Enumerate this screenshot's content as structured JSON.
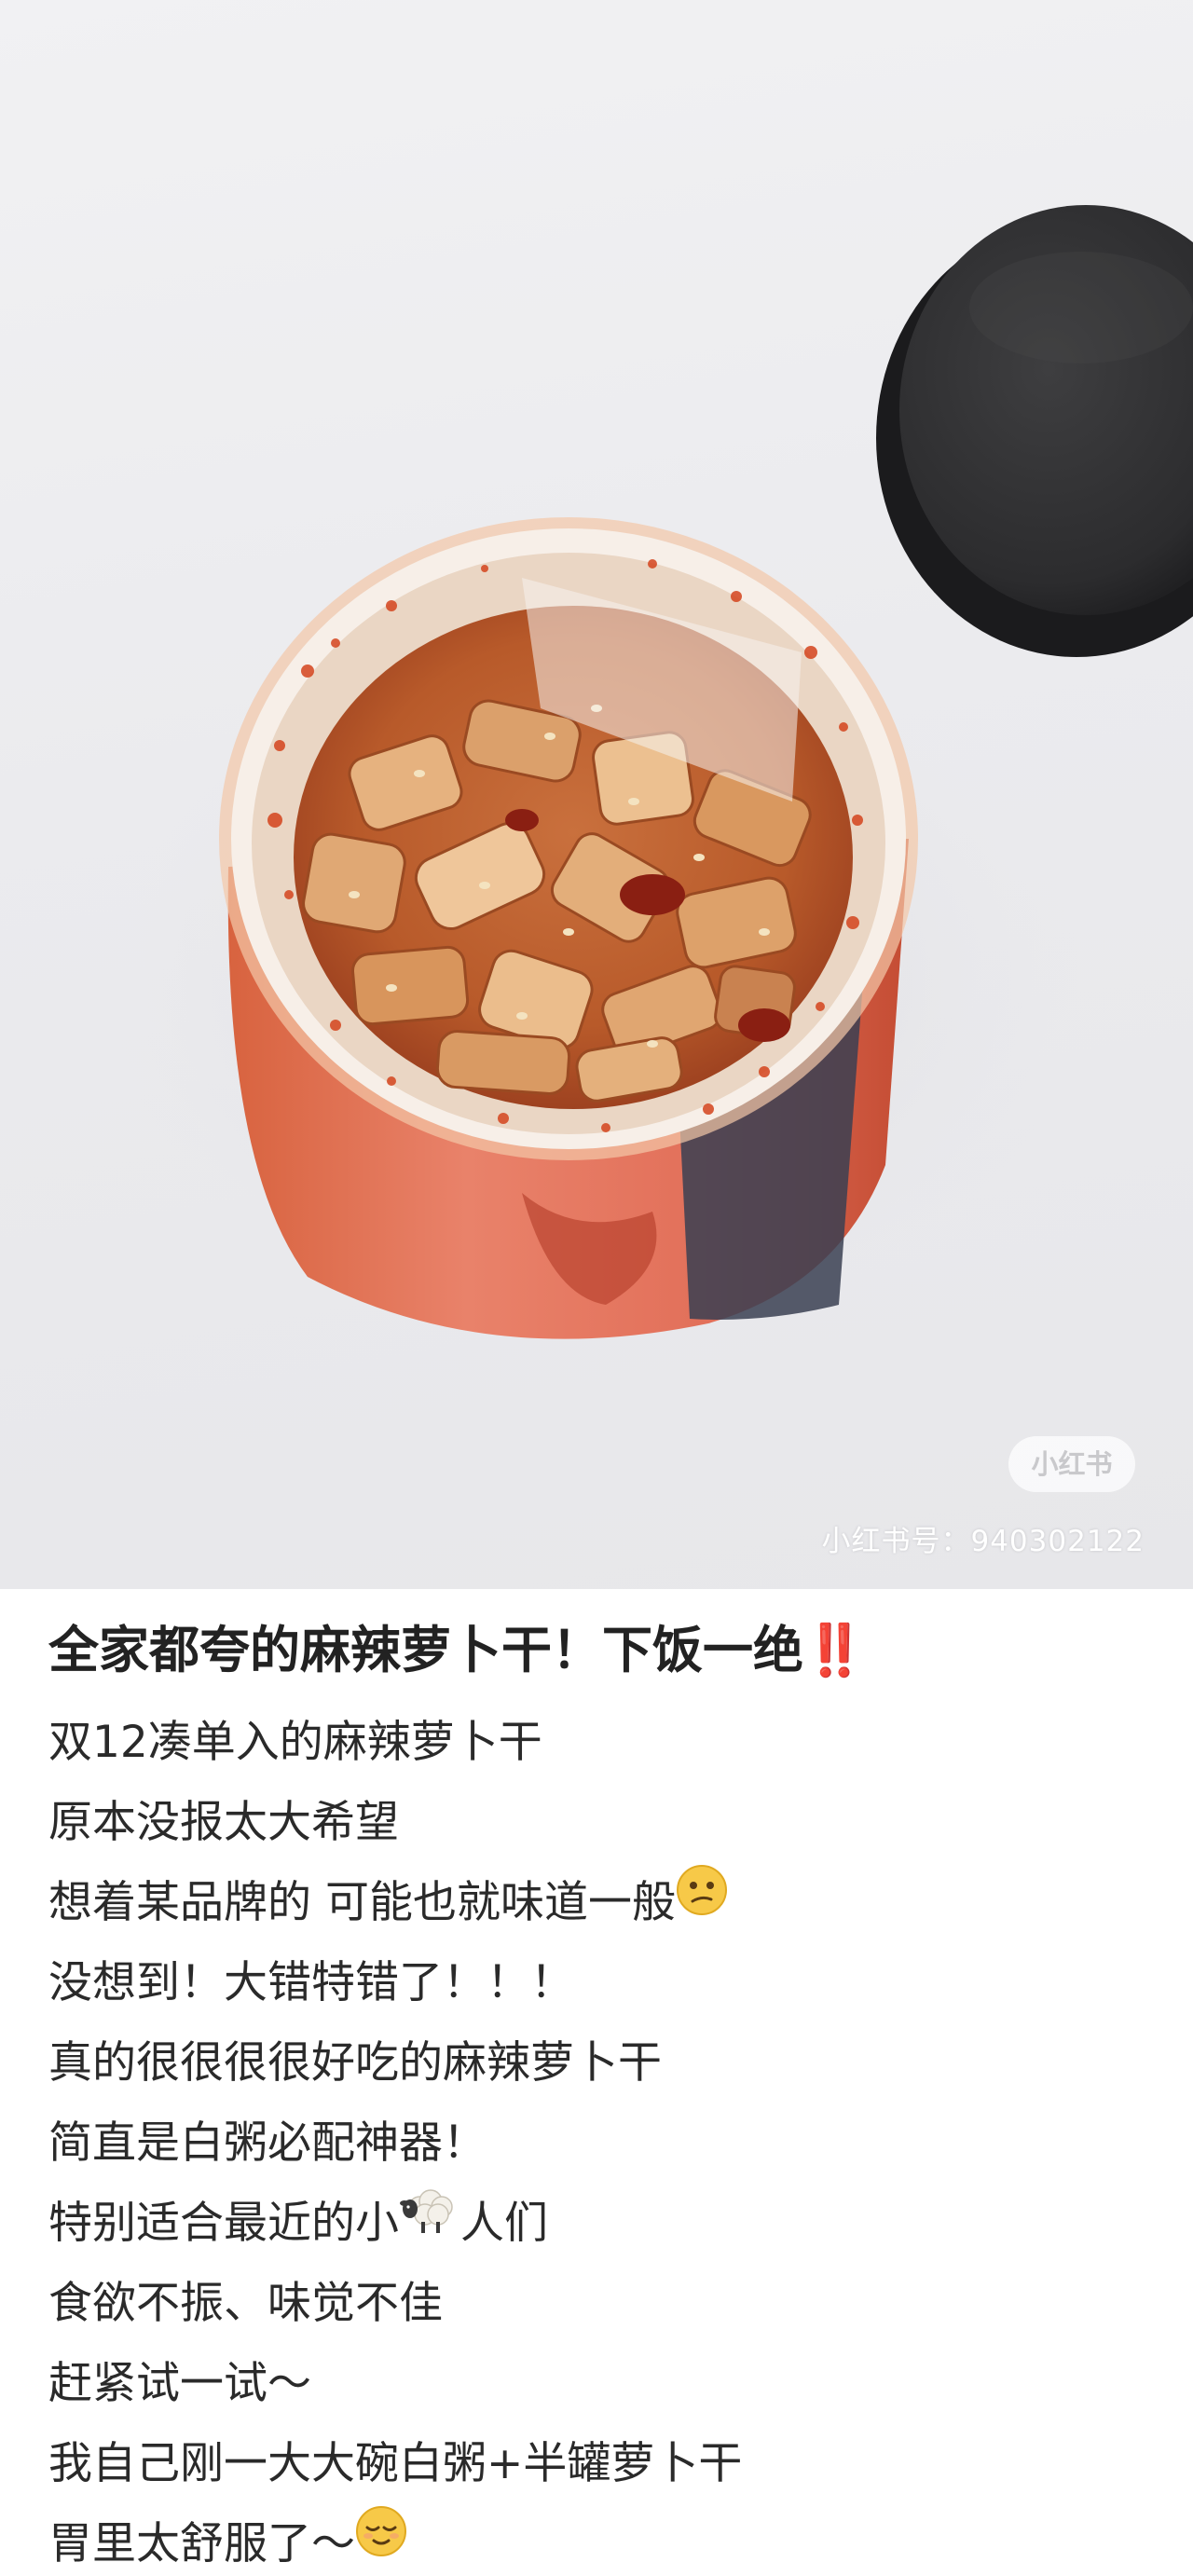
{
  "watermark": {
    "logo_text": "小红书",
    "id_text": "小红书号：940302122"
  },
  "post": {
    "title": "全家都夸的麻辣萝卜干！下饭一绝",
    "title_mark": "‼️",
    "lines": [
      {
        "text": "双12凑单入的麻辣萝卜干"
      },
      {
        "text": "原本没报太大希望"
      },
      {
        "text": "想着某品牌的 可能也就味道一般",
        "emoji": "confused-face-icon"
      },
      {
        "text": "没想到！大错特错了！！！"
      },
      {
        "text": "真的很很很很好吃的麻辣萝卜干"
      },
      {
        "text": "简直是白粥必配神器！"
      },
      {
        "text": "特别适合最近的小",
        "emoji": "sheep-icon",
        "after": "人们"
      },
      {
        "text": "食欲不振、味觉不佳"
      },
      {
        "text": "赶紧试一试～"
      },
      {
        "text": "我自己刚一大大碗白粥+半罐萝卜干"
      },
      {
        "text": "胃里太舒服了～",
        "emoji": "relieved-face-icon"
      }
    ]
  },
  "colors": {
    "title_mark": "#e52222",
    "text": "#2a2a2a",
    "background": "#ffffff"
  }
}
